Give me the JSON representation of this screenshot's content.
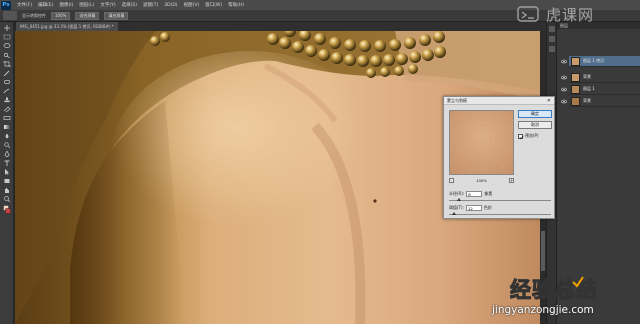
{
  "app": {
    "logo": "Ps",
    "menu": [
      "文件(F)",
      "编辑(E)",
      "图像(I)",
      "图层(L)",
      "文字(Y)",
      "选择(S)",
      "滤镜(T)",
      "3D(D)",
      "视图(V)",
      "窗口(W)",
      "帮助(H)"
    ]
  },
  "options": {
    "label1": "显示转换控件",
    "btn1": "100%",
    "btn2": "适合屏幕",
    "btn3": "填充屏幕"
  },
  "tab": {
    "title": "IMG_0451.jpg @ 33.3% (图层 1 拷贝, RGB/8#) *"
  },
  "brand": {
    "name": "虎课网"
  },
  "layers_panel": {
    "tab_label": "图层",
    "items": [
      {
        "name": "图层 1 拷贝",
        "selected": true
      },
      {
        "name": "背景",
        "selected": false
      },
      {
        "name": "图层 1",
        "selected": false
      },
      {
        "name": "背景",
        "selected": false
      }
    ]
  },
  "dialog": {
    "title": "蒙尘与划痕",
    "ok": "确定",
    "cancel": "取消",
    "preview_label": "预览(P)",
    "preview_checked": true,
    "zoom_minus": "-",
    "zoom_plus": "+",
    "zoom": "100%",
    "radius_label": "半径(R):",
    "radius_value": "8",
    "radius_unit": "像素",
    "radius_level": 0.1,
    "threshold_label": "阈值(T):",
    "threshold_value": "12",
    "threshold_unit": "色阶",
    "threshold_level": 0.05
  },
  "watermark": {
    "cn_part1": "经验",
    "cn_part2": "总结",
    "url": "jingyanzongjie.com"
  },
  "colors": {
    "accent": "#f0a400",
    "selection": "#506e8c"
  }
}
